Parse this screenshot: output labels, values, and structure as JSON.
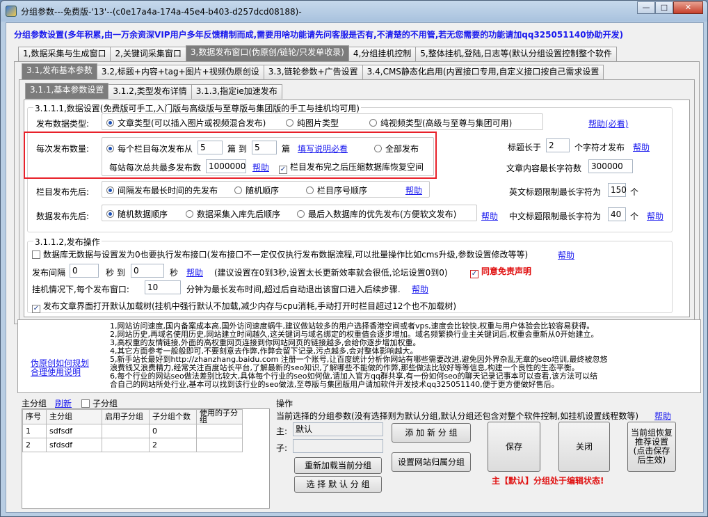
{
  "window": {
    "title": "分组参数---免费版-'13'--(c0e17a4a-174a-45e4-b403-d257dcd08188)-",
    "min": "—",
    "max": "□",
    "close": "✕"
  },
  "banner": "分组参数设置(多年积累,由一万余资深VIP用户多年反馈精制而成,需要用啥功能请先问客服是否有,不清楚的不用管,若无您需要的功能请加qq325051140协助开发)",
  "main_tabs": [
    "1,数据采集与生成窗口",
    "2,关键词采集窗口",
    "3,数据发布窗口(伪原创/链轮/只发单收录)",
    "4,分组挂机控制",
    "5,整体挂机,登陆,日志等(默认分组设置控制整个软件"
  ],
  "sub_tabs": [
    "3.1,发布基本参数",
    "3.2,标题+内容+tag+图片+视频伪原创设",
    "3.3,链轮参数+广告设置",
    "3.4,CMS静态化启用(内置接口专用,自定义接口按自己需求设置"
  ],
  "inner_tabs": [
    "3.1.1,基本参数设置",
    "3.1.2,类型发布详情",
    "3.1.3,指定ie加速发布"
  ],
  "group1": {
    "title": "3.1.1.1,数据设置(免费版可手工,入门版与高级版与至尊版与集团版的手工与挂机均可用)",
    "type_label": "发布数据类型:",
    "type_options": [
      "文章类型(可以插入图片或视频混合发布)",
      "纯图片类型",
      "纯视频类型(高级与至尊与集团可用)"
    ],
    "type_help": "帮助(必看)",
    "count_label": "每次发布数量:",
    "per_column": "每个栏目每次发布从",
    "from": "5",
    "unit1": "篇 到",
    "to": "5",
    "unit2": "篇",
    "fill_help": "填写说明必看",
    "all_publish": "全部发布",
    "max_label": "每站每次总共最多发布数",
    "max_value": "1000000",
    "max_help": "帮助",
    "compress_label": "栏目发布完之后压缩数据库恢复空间",
    "title_len_label": "标题长于",
    "title_len_value": "2",
    "title_len_suffix": "个字符才发布",
    "title_len_help": "帮助",
    "content_len_label": "文章内容最长字符数",
    "content_len_value": "300000",
    "column_order_label": "栏目发布先后:",
    "column_order_options": [
      "间隔发布最长时间的先发布",
      "随机顺序",
      "栏目序号顺序"
    ],
    "column_order_help": "帮助",
    "en_title_label": "英文标题限制最长字符为",
    "en_title_value": "150",
    "en_title_suffix": "个",
    "data_order_label": "数据发布先后:",
    "data_order_options": [
      "随机数据顺序",
      "数据采集入库先后顺序",
      "最后入数据库的优先发布(方便软文发布)"
    ],
    "data_order_help": "帮助",
    "cn_title_label": "中文标题限制最长字符为",
    "cn_title_value": "40",
    "cn_title_suffix": "个",
    "cn_title_help": "帮助"
  },
  "group2": {
    "title": "3.1.1.2,发布操作",
    "opt1": "数据库无数据与设置发为0也要执行发布接口(发布接口不一定仅仅执行发布数据流程,可以批量操作比如cms升级,参数设置修改等等)",
    "opt1_help": "帮助",
    "interval_label": "发布间隔",
    "interval_from": "0",
    "interval_mid": "秒 到",
    "interval_to": "0",
    "interval_unit": "秒",
    "interval_help": "帮助",
    "interval_note": "(建议设置在0到3秒,设置太长更新效率就会很低,论坛设置0到0)",
    "agree_label": "同意免责声明",
    "hang_label": "挂机情况下,每个发布窗口:",
    "hang_value": "10",
    "hang_note": "分钟为最长发布时间,超过后自动退出该窗口进入后续步骤.",
    "hang_help": "帮助",
    "opt2": "发布文章界面打开默认加载树(挂机中强行默认不加载,减少内存与cpu消耗,手动打开时栏目超过12个也不加载树)"
  },
  "notes": {
    "links": [
      "伪原创如何规划",
      "合理使用说明"
    ],
    "lines": [
      "1,网站访问速度,国内备案成本高,国外访问速度蜗牛,建议做站较多的用户选择香港空间或者vps,速度会比较快,权重与用户体验会比较容易获得。",
      "2,网站历史,再域名使用历史,网站建立时间越久,这关键词与域名绑定的权重值会逐步增加。域名频繁换行业主关键词后,权重会重新从0开始建立。",
      "3,高权重的友情链接,外面的高权重网页连接到你网站网页的链接越多,会给你逐步增加权重。",
      "4,其它方面参考一般般即可,不要刻意去作弊,作弊会留下记录,污点越多,会对整体影响越大。",
      "5,新手站长最好到http://zhanzhang.baidu.com  注册一个账号,让百度统计分析你网站有哪些需要改进,避免因外界杂乱无章的seo培训,最终被忽悠",
      "浪费钱又浪费精力,经常关注百度站长平台,了解最新的seo知识,了解哪些不能做的作弊,那些做法比较好等等信息,构建一个良性的生态平衡。",
      "6,每个行业的网站seo做法差别比较大,具体每个行业的seo如何做,请加入官方qq群共享,有一份如何seo的聊天记录记事本可以查看,该方法可以结",
      "合自己的网站所处行业,基本可以找到该行业的seo做法,至尊版与集团版用户请加软件开发技术qq325051140,便于更方便做好售后。"
    ]
  },
  "groups_panel": {
    "title": "主分组",
    "refresh": "刷新",
    "sub_group": "子分组",
    "headers": [
      "序号",
      "主分组",
      "启用子分组",
      "子分组个数",
      "使用的子分组"
    ],
    "rows": [
      [
        "1",
        "sdfsdf",
        "",
        "0",
        ""
      ],
      [
        "2",
        "sfdsdf",
        "",
        "2",
        ""
      ]
    ]
  },
  "ops": {
    "title": "操作",
    "desc": "当前选择的分组参数(没有选择则为默认分组,默认分组还包含对整个软件控制,如挂机设置线程数等)",
    "help": "帮助",
    "main_label": "主:",
    "main_value": "默认",
    "sub_label": "子:",
    "sub_value": "",
    "add_group": "添 加 新 分 组",
    "reload": "重新加载当前分组",
    "set_site": "设置网站归属分组",
    "select_default": "选 择 默 认 分 组",
    "save": "保存",
    "close": "关闭",
    "restore": "当前组恢复推荐设置(点击保存后生效)",
    "status": "主【默认】分组处于编辑状态!"
  }
}
